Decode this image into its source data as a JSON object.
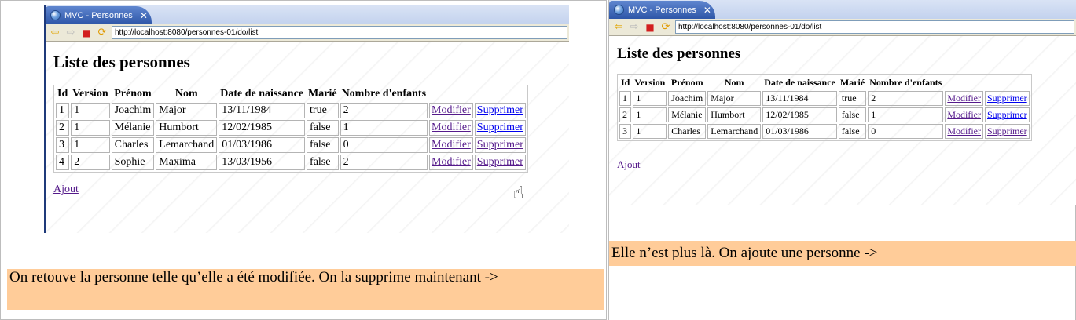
{
  "browser": {
    "tab_title": "MVC - Personnes",
    "tab_close": "✕",
    "url": "http://localhost:8080/personnes-01/do/list",
    "icons": {
      "back": "back-arrow-icon",
      "forward": "forward-arrow-icon",
      "stop": "stop-icon",
      "refresh": "refresh-icon",
      "favicon": "globe-icon"
    }
  },
  "page": {
    "heading": "Liste des personnes",
    "columns": [
      "Id",
      "Version",
      "Prénom",
      "Nom",
      "Date de naissance",
      "Marié",
      "Nombre d'enfants"
    ],
    "modify_label": "Modifier",
    "delete_label": "Supprimer",
    "add_label": "Ajout"
  },
  "left": {
    "rows": [
      [
        "1",
        "1",
        "Joachim",
        "Major",
        "13/11/1984",
        "true",
        "2"
      ],
      [
        "2",
        "1",
        "Mélanie",
        "Humbort",
        "12/02/1985",
        "false",
        "1"
      ],
      [
        "3",
        "1",
        "Charles",
        "Lemarchand",
        "01/03/1986",
        "false",
        "0"
      ],
      [
        "4",
        "2",
        "Sophie",
        "Maxima",
        "13/03/1956",
        "false",
        "2"
      ]
    ],
    "caption": "On retouve la personne telle qu’elle a été modifiée. On la supprime maintenant ->"
  },
  "right": {
    "rows": [
      [
        "1",
        "1",
        "Joachim",
        "Major",
        "13/11/1984",
        "true",
        "2"
      ],
      [
        "2",
        "1",
        "Mélanie",
        "Humbort",
        "12/02/1985",
        "false",
        "1"
      ],
      [
        "3",
        "1",
        "Charles",
        "Lemarchand",
        "01/03/1986",
        "false",
        "0"
      ]
    ],
    "caption": "Elle n’est plus là. On ajoute une personne ->"
  },
  "colors": {
    "caption_bg": "#ffcc99",
    "link_visited": "#551a8b",
    "link_unvisited": "#0000ee",
    "tab_blue": "#2e56a8"
  }
}
